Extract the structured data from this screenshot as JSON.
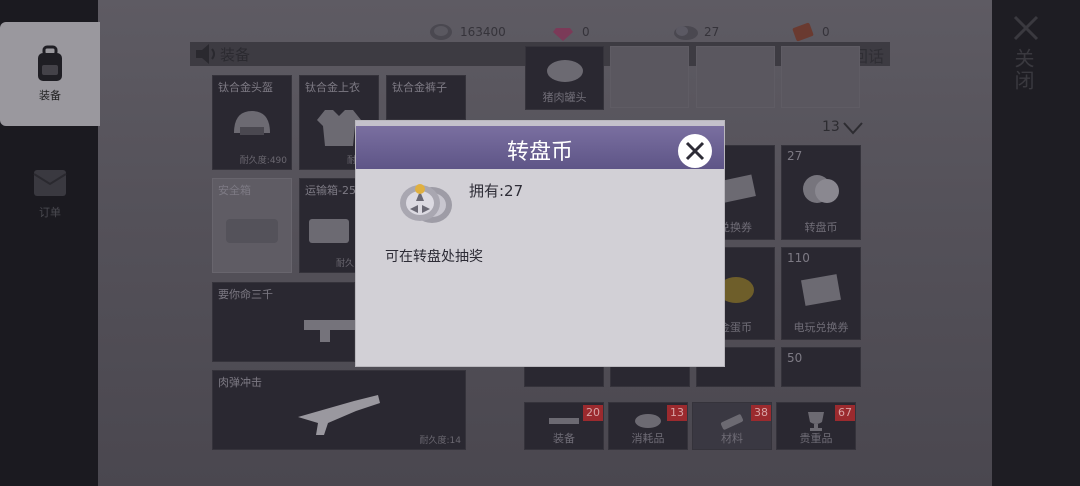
{
  "side_tabs": [
    {
      "label": "装备",
      "icon": "backpack-icon"
    },
    {
      "label": "订单",
      "icon": "envelope-icon"
    }
  ],
  "resources": [
    {
      "icon": "coin-icon",
      "value": "163400"
    },
    {
      "icon": "gem-icon",
      "value": "0"
    },
    {
      "icon": "spin-coin-icon",
      "value": "27"
    },
    {
      "icon": "ticket-icon",
      "value": "0"
    }
  ],
  "header": {
    "title": "装备",
    "return_label": "回家回话"
  },
  "close_label": "关闭",
  "equipment": [
    {
      "name": "钛合金头盔",
      "durability": "耐久度:490"
    },
    {
      "name": "钛合金上衣",
      "durability": "耐久度"
    },
    {
      "name": "钛合金裤子",
      "durability": ""
    },
    {
      "name": "安全箱",
      "durability": ""
    },
    {
      "name": "运输箱-25",
      "durability": "耐久"
    },
    {
      "name": "要你命三千",
      "durability": ""
    },
    {
      "name": "肉弹冲击",
      "durability": "耐久度:14"
    }
  ],
  "inventory": {
    "top_item": {
      "name": "猪肉罐头"
    },
    "count": "13",
    "items": [
      {
        "count": "",
        "name": "兑换券"
      },
      {
        "count": "27",
        "name": "转盘币"
      },
      {
        "count": "",
        "name": "金蛋币"
      },
      {
        "count": "110",
        "name": "电玩兑换券"
      },
      {
        "count": "50",
        "name": ""
      }
    ]
  },
  "categories": [
    {
      "label": "装备",
      "badge": "20"
    },
    {
      "label": "消耗品",
      "badge": "13"
    },
    {
      "label": "材料",
      "badge": "38"
    },
    {
      "label": "贵重品",
      "badge": "67"
    }
  ],
  "modal": {
    "title": "转盘币",
    "owned": "拥有:27",
    "description": "可在转盘处抽奖"
  },
  "colors": {
    "modal_header": "#6b6194",
    "badge": "#9b2a2e"
  }
}
